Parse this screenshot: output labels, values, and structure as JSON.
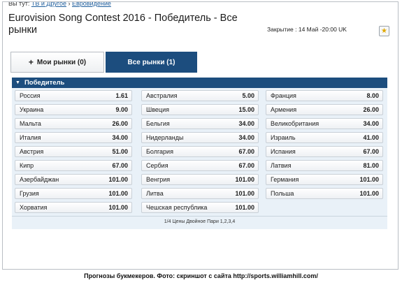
{
  "breadcrumb": {
    "prefix": "Вы тут:",
    "items": [
      "ТВ и Другое",
      "Евровидение"
    ]
  },
  "page_title": "Eurovision Song Contest 2016 - Победитель - Все рынки",
  "closing": "Закрытие : 14 Май -20:00 UK",
  "tabs": [
    {
      "label": "Мои рынки (0)",
      "icon": "plus-icon",
      "active": false
    },
    {
      "label": "Все рынки (1)",
      "active": true
    }
  ],
  "market": {
    "title": "Победитель",
    "icon": "triangle-down-icon"
  },
  "selections": [
    [
      {
        "name": "Россия",
        "odds": "1.61"
      },
      {
        "name": "Украина",
        "odds": "9.00"
      },
      {
        "name": "Мальта",
        "odds": "26.00"
      },
      {
        "name": "Италия",
        "odds": "34.00"
      },
      {
        "name": "Австрия",
        "odds": "51.00"
      },
      {
        "name": "Кипр",
        "odds": "67.00"
      },
      {
        "name": "Азербайджан",
        "odds": "101.00"
      },
      {
        "name": "Грузия",
        "odds": "101.00"
      },
      {
        "name": "Хорватия",
        "odds": "101.00"
      }
    ],
    [
      {
        "name": "Австралия",
        "odds": "5.00"
      },
      {
        "name": "Швеция",
        "odds": "15.00"
      },
      {
        "name": "Бельгия",
        "odds": "34.00"
      },
      {
        "name": "Нидерланды",
        "odds": "34.00"
      },
      {
        "name": "Болгария",
        "odds": "67.00"
      },
      {
        "name": "Сербия",
        "odds": "67.00"
      },
      {
        "name": "Венгрия",
        "odds": "101.00"
      },
      {
        "name": "Литва",
        "odds": "101.00"
      },
      {
        "name": "Чешская республика",
        "odds": "101.00"
      }
    ],
    [
      {
        "name": "Франция",
        "odds": "8.00"
      },
      {
        "name": "Армения",
        "odds": "26.00"
      },
      {
        "name": "Великобритания",
        "odds": "34.00"
      },
      {
        "name": "Израиль",
        "odds": "41.00"
      },
      {
        "name": "Испания",
        "odds": "67.00"
      },
      {
        "name": "Латвия",
        "odds": "81.00"
      },
      {
        "name": "Германия",
        "odds": "101.00"
      },
      {
        "name": "Польша",
        "odds": "101.00"
      }
    ]
  ],
  "footer_note": "1/4 Цены Двойное Пари 1,2,3,4",
  "caption": "Прогнозы букмекеров. Фото: скриншот с сайта http://sports.williamhill.com/",
  "colors": {
    "brand": "#1c4d7e",
    "cell_bg": "#f3f5f7",
    "grid_bg": "#e9f1f8"
  }
}
